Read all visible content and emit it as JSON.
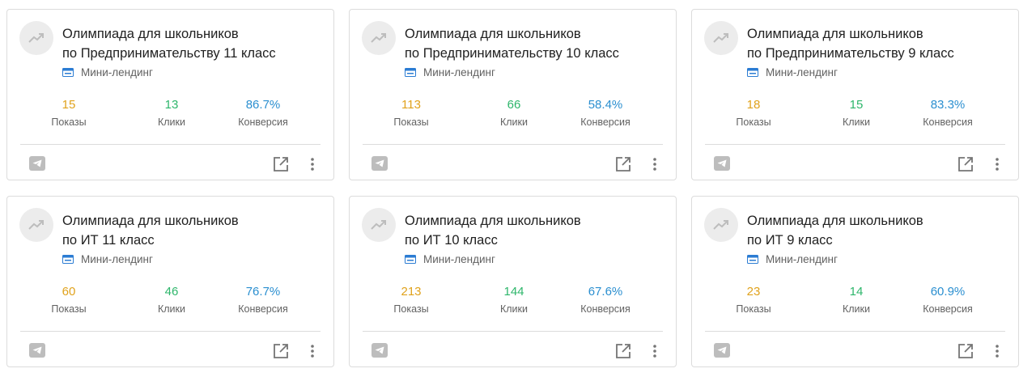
{
  "cards": [
    {
      "title_line1": "Олимпиада для школьников",
      "title_line2": "по Предпринимательству 11 класс",
      "type": "Мини-лендинг",
      "shows_value": "15",
      "shows_label": "Показы",
      "clicks_value": "13",
      "clicks_label": "Клики",
      "conv_value": "86.7%",
      "conv_label": "Конверсия"
    },
    {
      "title_line1": "Олимпиада для школьников",
      "title_line2": "по Предпринимательству 10 класс",
      "type": "Мини-лендинг",
      "shows_value": "113",
      "shows_label": "Показы",
      "clicks_value": "66",
      "clicks_label": "Клики",
      "conv_value": "58.4%",
      "conv_label": "Конверсия"
    },
    {
      "title_line1": "Олимпиада для школьников",
      "title_line2": "по Предпринимательству 9 класс",
      "type": "Мини-лендинг",
      "shows_value": "18",
      "shows_label": "Показы",
      "clicks_value": "15",
      "clicks_label": "Клики",
      "conv_value": "83.3%",
      "conv_label": "Конверсия"
    },
    {
      "title_line1": "Олимпиада для школьников",
      "title_line2": "по ИТ 11 класс",
      "type": "Мини-лендинг",
      "shows_value": "60",
      "shows_label": "Показы",
      "clicks_value": "46",
      "clicks_label": "Клики",
      "conv_value": "76.7%",
      "conv_label": "Конверсия"
    },
    {
      "title_line1": "Олимпиада для школьников",
      "title_line2": "по ИТ 10 класс",
      "type": "Мини-лендинг",
      "shows_value": "213",
      "shows_label": "Показы",
      "clicks_value": "144",
      "clicks_label": "Клики",
      "conv_value": "67.6%",
      "conv_label": "Конверсия"
    },
    {
      "title_line1": "Олимпиада для школьников",
      "title_line2": "по ИТ 9 класс",
      "type": "Мини-лендинг",
      "shows_value": "23",
      "shows_label": "Показы",
      "clicks_value": "14",
      "clicks_label": "Клики",
      "conv_value": "60.9%",
      "conv_label": "Конверсия"
    }
  ],
  "icons": {
    "card_icon": "trending-up-icon",
    "type_icon": "landing-page-icon",
    "telegram": "telegram-icon",
    "open": "open-in-new-icon",
    "more": "more-vertical-icon"
  },
  "colors": {
    "shows": "#e0a21c",
    "clicks": "#2eb66b",
    "conversion": "#2b8fd0",
    "type_icon": "#2b7cd3"
  }
}
